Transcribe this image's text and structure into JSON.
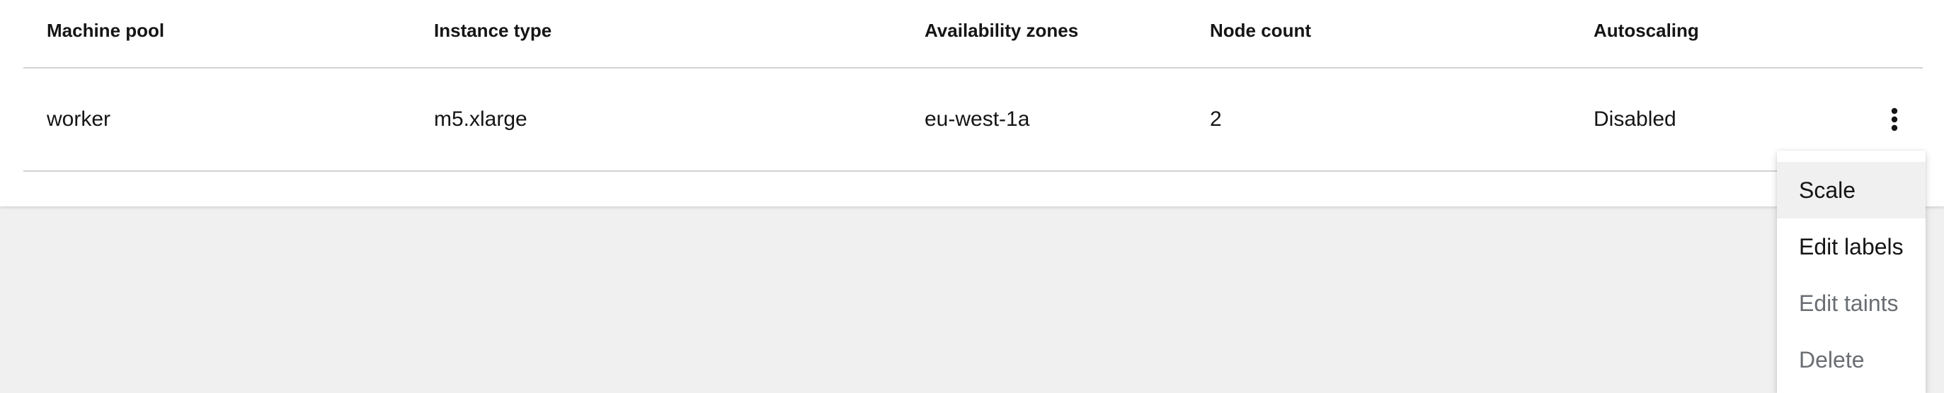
{
  "table": {
    "columns": [
      "Machine pool",
      "Instance type",
      "Availability zones",
      "Node count",
      "Autoscaling"
    ],
    "rows": [
      {
        "machine_pool": "worker",
        "instance_type": "m5.xlarge",
        "availability_zones": "eu-west-1a",
        "node_count": "2",
        "autoscaling": "Disabled"
      }
    ]
  },
  "actions_menu": {
    "items": [
      {
        "label": "Scale",
        "state": "hovered"
      },
      {
        "label": "Edit labels",
        "state": "enabled"
      },
      {
        "label": "Edit taints",
        "state": "disabled"
      },
      {
        "label": "Delete",
        "state": "disabled"
      }
    ]
  },
  "icons": {
    "row_actions": "kebab-vertical-icon"
  },
  "colors": {
    "text": "#151515",
    "disabled_text": "#6a6e73",
    "border": "#d2d2d2",
    "page_background": "#f0f0f0",
    "hover_background": "#f0f0f0"
  }
}
